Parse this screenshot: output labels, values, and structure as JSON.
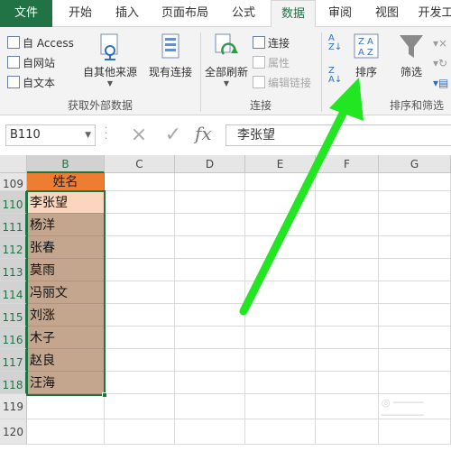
{
  "tabs": {
    "file": "文件",
    "start": "开始",
    "insert": "插入",
    "page_layout": "页面布局",
    "formulas": "公式",
    "data": "数据",
    "review": "审阅",
    "view": "视图",
    "developer": "开发工"
  },
  "ribbon": {
    "get_external": {
      "from_access": "自 Access",
      "from_web": "自网站",
      "from_text": "自文本",
      "from_other": "自其他来源",
      "existing_conn": "现有连接",
      "label": "获取外部数据"
    },
    "connections": {
      "refresh_all": "全部刷新",
      "connections": "连接",
      "properties": "属性",
      "edit_links": "编辑链接",
      "label": "连接"
    },
    "sort_filter": {
      "sort": "排序",
      "filter": "筛选",
      "label": "排序和筛选"
    }
  },
  "formula_bar": {
    "name_box": "B110",
    "cancel_icon": "×",
    "enter_icon": "✓",
    "fx": "fx",
    "content": "李张望"
  },
  "columns": [
    "B",
    "C",
    "D",
    "E",
    "F",
    "G"
  ],
  "rows": [
    "109",
    "110",
    "111",
    "112",
    "113",
    "114",
    "115",
    "116",
    "117",
    "118",
    "119",
    "120"
  ],
  "cells": {
    "header": "姓名",
    "names": [
      "李张望",
      "杨洋",
      "张春",
      "莫雨",
      "冯丽文",
      "刘涨",
      "木子",
      "赵良",
      "汪海"
    ]
  },
  "colors": {
    "excel_green": "#217346",
    "header_orange": "#ed7d31",
    "data_fill": "#c4a68f",
    "active_cell": "#fbd5bd",
    "arrow_green": "#22e622"
  }
}
